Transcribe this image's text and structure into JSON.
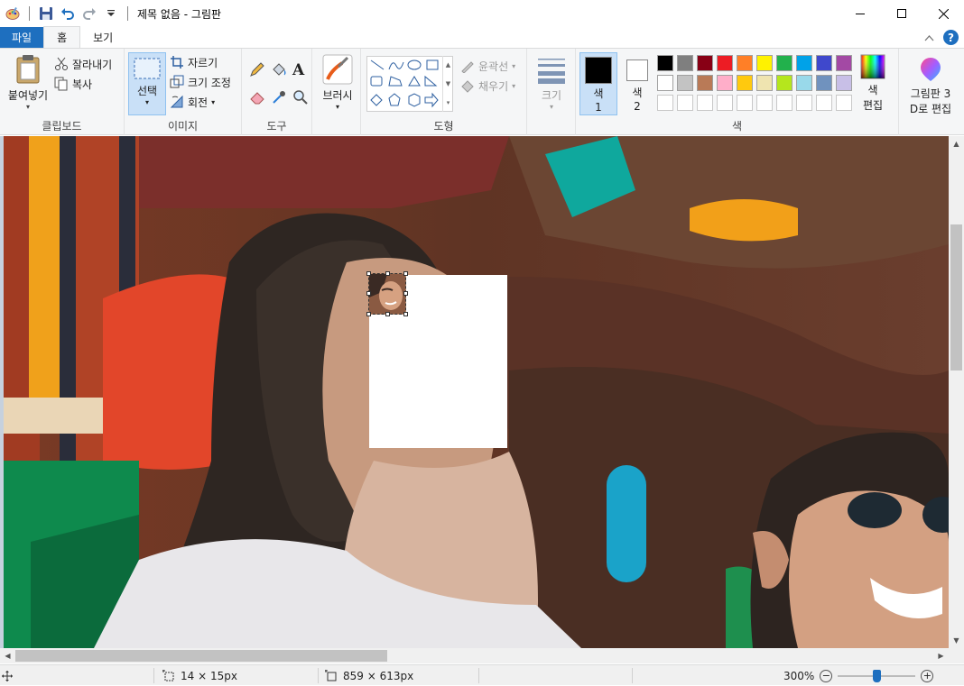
{
  "window": {
    "title": "제목 없음 - 그림판"
  },
  "tabs": [
    {
      "label": "파일"
    },
    {
      "label": "홈"
    },
    {
      "label": "보기"
    }
  ],
  "clipboard": {
    "paste": "붙여넣기",
    "cut": "잘라내기",
    "copy": "복사",
    "label": "클립보드"
  },
  "image": {
    "select": "선택",
    "crop": "자르기",
    "resize": "크기 조정",
    "rotate": "회전",
    "label": "이미지"
  },
  "tools": {
    "label": "도구",
    "text_glyph": "A"
  },
  "brushes": {
    "label": "브러시"
  },
  "shapes": {
    "outline": "윤곽선",
    "fill": "채우기",
    "label": "도형"
  },
  "size": {
    "label": "크기"
  },
  "colors": {
    "color1": "색\n1",
    "color1_line1": "색",
    "color1_line2": "1",
    "color2_line1": "색",
    "color2_line2": "2",
    "edit_line1": "색",
    "edit_line2": "편집",
    "paint3d_line1": "그림판 3",
    "paint3d_line2": "D로 편집",
    "label": "색",
    "color1_value": "#000000",
    "color2_value": "#ffffff",
    "palette_row1": [
      "#000000",
      "#7f7f7f",
      "#880015",
      "#ed1c24",
      "#ff7f27",
      "#fff200",
      "#22b14c",
      "#00a2e8",
      "#3f48cc",
      "#a349a4"
    ],
    "palette_row2": [
      "#ffffff",
      "#c3c3c3",
      "#b97a57",
      "#ffaec9",
      "#ffc90e",
      "#efe4b0",
      "#b5e61d",
      "#99d9ea",
      "#7092be",
      "#c8bfe7"
    ],
    "palette_row3": [
      "#ffffff",
      "#ffffff",
      "#ffffff",
      "#ffffff",
      "#ffffff",
      "#ffffff",
      "#ffffff",
      "#ffffff",
      "#ffffff",
      "#ffffff"
    ]
  },
  "status": {
    "selection_size": "14 × 15px",
    "image_size": "859 × 613px",
    "zoom": "300%",
    "zoom_level": 0.5
  }
}
